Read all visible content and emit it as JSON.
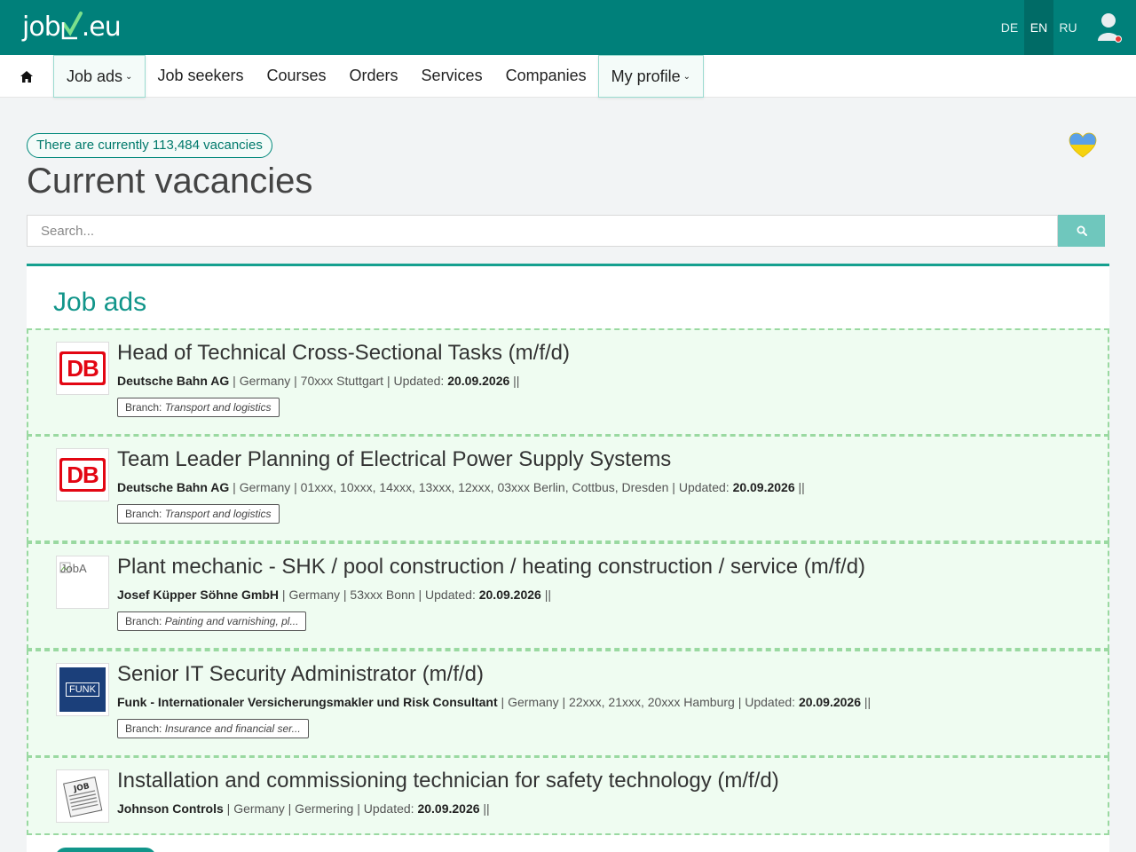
{
  "header": {
    "logo_left": "job",
    "logo_right": ".eu",
    "languages": [
      {
        "label": "DE",
        "active": false
      },
      {
        "label": "EN",
        "active": true
      },
      {
        "label": "RU",
        "active": false
      }
    ],
    "user_icon": "user-icon"
  },
  "nav": {
    "home_icon": "home-icon",
    "items": [
      {
        "label": "Job ads",
        "dropdown": true
      },
      {
        "label": "Job seekers",
        "dropdown": false
      },
      {
        "label": "Courses",
        "dropdown": false
      },
      {
        "label": "Orders",
        "dropdown": false
      },
      {
        "label": "Services",
        "dropdown": false
      },
      {
        "label": "Companies",
        "dropdown": false
      },
      {
        "label": "My profile",
        "dropdown": true
      }
    ]
  },
  "intro": {
    "vacancies_badge": "There are currently 113,484 vacancies",
    "title": "Current vacancies",
    "heart_icon": "ukraine-heart-icon"
  },
  "search": {
    "placeholder": "Search...",
    "button_icon": "search-icon"
  },
  "section": {
    "title": "Job ads"
  },
  "jobs": [
    {
      "title": "Head of Technical Cross-Sectional Tasks (m/f/d)",
      "company": "Deutsche Bahn AG",
      "meta": " | Germany | 70xxx Stuttgart | Updated: ",
      "date": "20.09.2026",
      "suffix": " ||",
      "branch_label": "Branch:",
      "branch": "Transport and logistics",
      "logo": "db"
    },
    {
      "title": "Team Leader Planning of Electrical Power Supply Systems",
      "company": "Deutsche Bahn AG",
      "meta": " | Germany | 01xxx, 10xxx, 14xxx, 13xxx, 12xxx, 03xxx Berlin, Cottbus, Dresden | Updated: ",
      "date": "20.09.2026",
      "suffix": " ||",
      "branch_label": "Branch:",
      "branch": "Transport and logistics",
      "logo": "db"
    },
    {
      "title": "Plant mechanic - SHK / pool construction / heating construction / service (m/f/d)",
      "company": "Josef Küpper Söhne GmbH",
      "meta": " | Germany | 53xxx Bonn | Updated: ",
      "date": "20.09.2026",
      "suffix": " ||",
      "branch_label": "Branch:",
      "branch": "Painting and varnishing, pl...",
      "logo": "broken",
      "logo_alt": "JobA"
    },
    {
      "title": "Senior IT Security Administrator (m/f/d)",
      "company": "Funk - Internationaler Versicherungsmakler und Risk Consultant",
      "meta": " | Germany | 22xxx, 21xxx, 20xxx Hamburg | Updated: ",
      "date": "20.09.2026",
      "suffix": " ||",
      "branch_label": "Branch:",
      "branch": "Insurance and financial ser...",
      "logo": "funk",
      "logo_text": "FUNK"
    },
    {
      "title": "Installation and commissioning technician for safety technology (m/f/d)",
      "company": "Johnson Controls",
      "meta": " | Germany | Germering | Updated: ",
      "date": "20.09.2026",
      "suffix": " ||",
      "logo": "newspaper",
      "logo_text": "JOB"
    }
  ],
  "colors": {
    "brand": "#00807a",
    "accent": "#11958a",
    "job_bg": "#effcf1"
  }
}
